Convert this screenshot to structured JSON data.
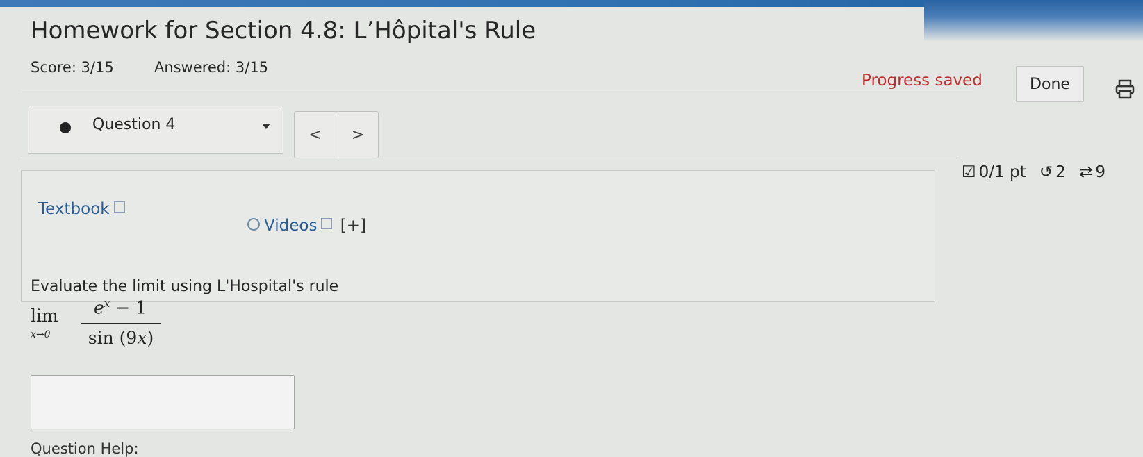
{
  "header": {
    "title": "Homework for Section 4.8: L’Hôpital's Rule",
    "score": "Score: 3/15",
    "answered": "Answered: 3/15",
    "progress_status": "Progress saved",
    "done_label": "Done"
  },
  "question_nav": {
    "selected": "Question 4",
    "prev_label": "<",
    "next_label": ">"
  },
  "question_meta": {
    "points": "0/1 pt",
    "retries": "2",
    "attempts_partial": "9"
  },
  "resources": {
    "textbook_label": "Textbook",
    "videos_label": "Videos",
    "videos_expand": "[+]"
  },
  "problem": {
    "prompt": "Evaluate the limit using L'Hospital's rule",
    "lim_word": "lim",
    "lim_sub": "x→0",
    "numerator_base": "e",
    "numerator_exp": "x",
    "numerator_rest": " − 1",
    "denominator_fn": "sin (9",
    "denominator_var": "x",
    "denominator_close": ")"
  },
  "answer": {
    "value": ""
  },
  "help": {
    "label": "Question Help:"
  }
}
